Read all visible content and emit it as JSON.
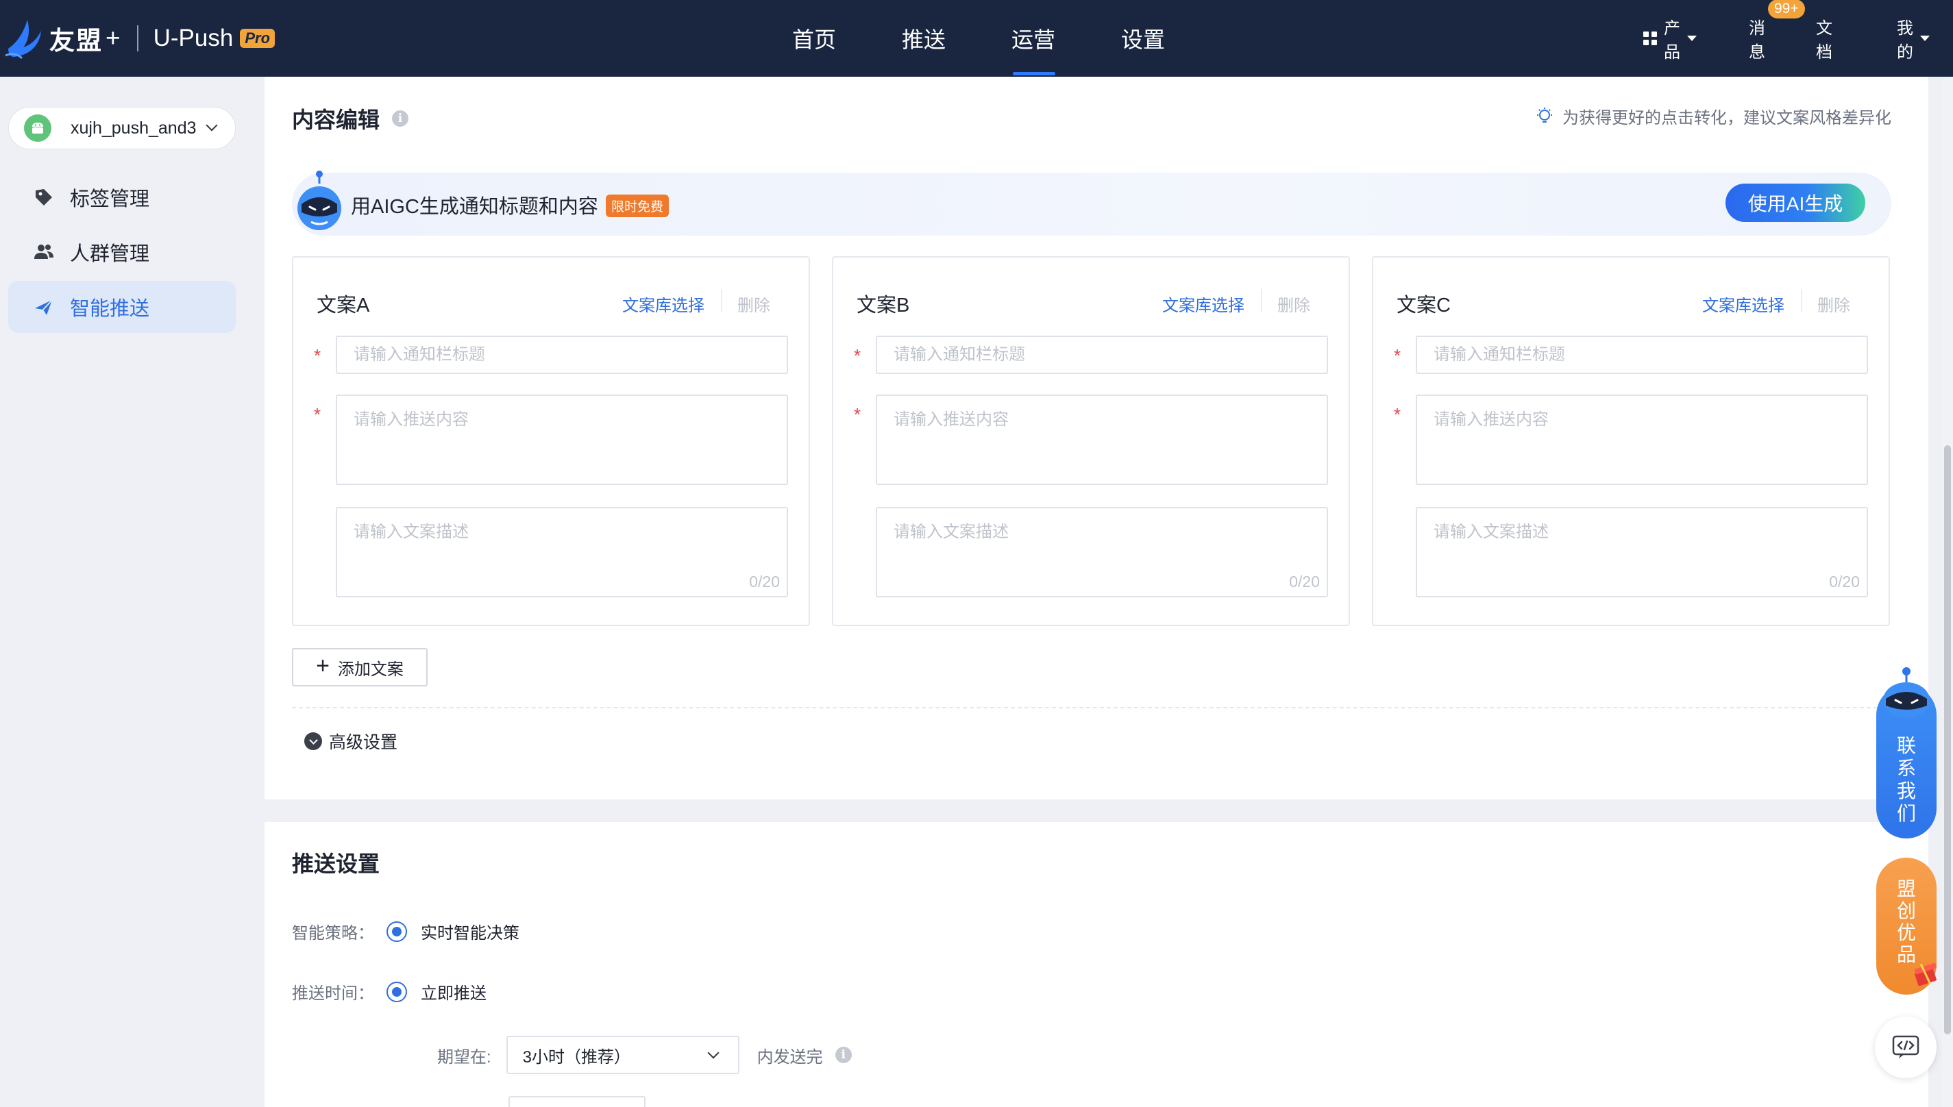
{
  "brand": {
    "name": "友盟",
    "plus": "+",
    "product": "U-Push",
    "tier": "Pro"
  },
  "nav": {
    "items": [
      "首页",
      "推送",
      "运营",
      "设置"
    ],
    "active": "运营"
  },
  "header_right": {
    "products": "产品",
    "messages": "消息",
    "messages_badge": "99+",
    "docs": "文档",
    "mine": "我的"
  },
  "sidebar": {
    "app_name": "xujh_push_and3",
    "items": [
      {
        "label": "标签管理",
        "icon": "tag-icon",
        "active": false
      },
      {
        "label": "人群管理",
        "icon": "users-icon",
        "active": false
      },
      {
        "label": "智能推送",
        "icon": "send-icon",
        "active": true
      }
    ]
  },
  "content_edit": {
    "title": "内容编辑",
    "tip": "为获得更好的点击转化，建议文案风格差异化",
    "aigc": {
      "text": "用AIGC生成通知标题和内容",
      "tag": "限时免费",
      "button": "使用AI生成"
    },
    "copies": [
      {
        "name": "文案A",
        "pick": "文案库选择",
        "delete": "删除",
        "title_placeholder": "请输入通知栏标题",
        "body_placeholder": "请输入推送内容",
        "desc_placeholder": "请输入文案描述",
        "counter": "0/20"
      },
      {
        "name": "文案B",
        "pick": "文案库选择",
        "delete": "删除",
        "title_placeholder": "请输入通知栏标题",
        "body_placeholder": "请输入推送内容",
        "desc_placeholder": "请输入文案描述",
        "counter": "0/20"
      },
      {
        "name": "文案C",
        "pick": "文案库选择",
        "delete": "删除",
        "title_placeholder": "请输入通知栏标题",
        "body_placeholder": "请输入推送内容",
        "desc_placeholder": "请输入文案描述",
        "counter": "0/20"
      }
    ],
    "add_copy": "添加文案",
    "advanced": "高级设置"
  },
  "push_settings": {
    "title": "推送设置",
    "strategy_label": "智能策略：",
    "strategy_value": "实时智能决策",
    "time_label": "推送时间：",
    "time_value": "立即推送",
    "expect_label": "期望在:",
    "expect_value": "3小时（推荐）",
    "expect_suffix": "内发送完"
  },
  "floating": {
    "contact": "联系我们",
    "mengchuang": "盟创优品"
  },
  "colors": {
    "topbar": "#1a2640",
    "accent": "#2f6fe0",
    "orange": "#f07a2c",
    "required": "#e5484d"
  }
}
